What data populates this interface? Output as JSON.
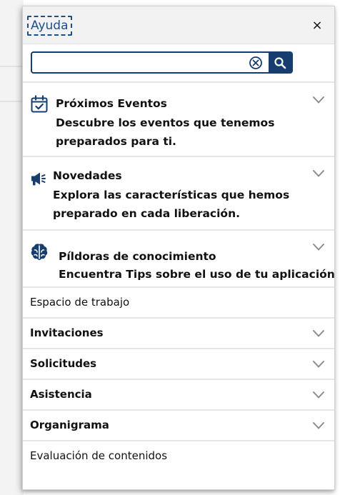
{
  "panel": {
    "title": "Ayuda",
    "close_label": "×",
    "close_icon": "close-icon"
  },
  "search": {
    "value": "",
    "placeholder": "",
    "clear_icon": "clear-circle-x-icon",
    "search_icon": "magnifier-icon"
  },
  "featured": [
    {
      "icon": "calendar-check-icon",
      "title": "Próximos Eventos",
      "description": "Descubre los eventos que tenemos preparados para ti."
    },
    {
      "icon": "megaphone-icon",
      "title": "Novedades",
      "description": "Explora las características que hemos preparado en cada liberación."
    },
    {
      "icon": "brain-icon",
      "title": "Píldoras de conocimiento",
      "description": "Encuentra Tips sobre el uso de tu aplicación."
    }
  ],
  "menu": [
    {
      "label": "Espacio de trabajo",
      "bold": false,
      "expandable": false
    },
    {
      "label": "Invitaciones",
      "bold": true,
      "expandable": true
    },
    {
      "label": "Solicitudes",
      "bold": true,
      "expandable": true
    },
    {
      "label": "Asistencia",
      "bold": true,
      "expandable": true
    },
    {
      "label": "Organigrama",
      "bold": true,
      "expandable": true
    },
    {
      "label": "Evaluación de contenidos",
      "bold": false,
      "expandable": false
    }
  ],
  "colors": {
    "primary": "#173d6f",
    "title_text": "#1b4f8a",
    "header_bg": "#f2f2f2",
    "divider": "#e6e6e6",
    "chevron": "#8c8c8c"
  }
}
